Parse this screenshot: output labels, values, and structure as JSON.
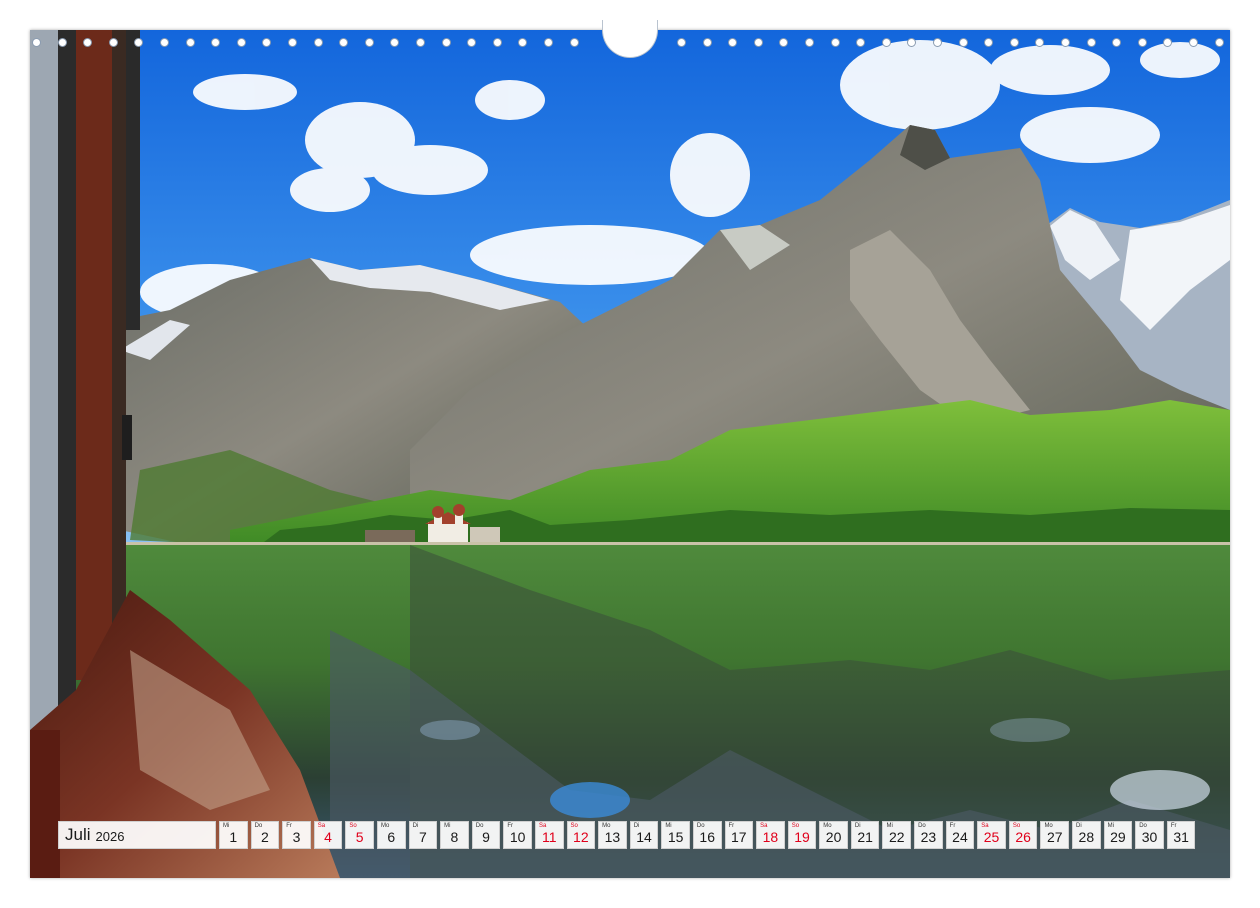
{
  "calendar": {
    "month": "Juli",
    "year": "2026",
    "days": [
      {
        "abbr": "Mi",
        "num": "1",
        "weekend": false
      },
      {
        "abbr": "Do",
        "num": "2",
        "weekend": false
      },
      {
        "abbr": "Fr",
        "num": "3",
        "weekend": false
      },
      {
        "abbr": "Sa",
        "num": "4",
        "weekend": true
      },
      {
        "abbr": "So",
        "num": "5",
        "weekend": true
      },
      {
        "abbr": "Mo",
        "num": "6",
        "weekend": false
      },
      {
        "abbr": "Di",
        "num": "7",
        "weekend": false
      },
      {
        "abbr": "Mi",
        "num": "8",
        "weekend": false
      },
      {
        "abbr": "Do",
        "num": "9",
        "weekend": false
      },
      {
        "abbr": "Fr",
        "num": "10",
        "weekend": false
      },
      {
        "abbr": "Sa",
        "num": "11",
        "weekend": true
      },
      {
        "abbr": "So",
        "num": "12",
        "weekend": true
      },
      {
        "abbr": "Mo",
        "num": "13",
        "weekend": false
      },
      {
        "abbr": "Di",
        "num": "14",
        "weekend": false
      },
      {
        "abbr": "Mi",
        "num": "15",
        "weekend": false
      },
      {
        "abbr": "Do",
        "num": "16",
        "weekend": false
      },
      {
        "abbr": "Fr",
        "num": "17",
        "weekend": false
      },
      {
        "abbr": "Sa",
        "num": "18",
        "weekend": true
      },
      {
        "abbr": "So",
        "num": "19",
        "weekend": true
      },
      {
        "abbr": "Mo",
        "num": "20",
        "weekend": false
      },
      {
        "abbr": "Di",
        "num": "21",
        "weekend": false
      },
      {
        "abbr": "Mi",
        "num": "22",
        "weekend": false
      },
      {
        "abbr": "Do",
        "num": "23",
        "weekend": false
      },
      {
        "abbr": "Fr",
        "num": "24",
        "weekend": false
      },
      {
        "abbr": "Sa",
        "num": "25",
        "weekend": true
      },
      {
        "abbr": "So",
        "num": "26",
        "weekend": true
      },
      {
        "abbr": "Mo",
        "num": "27",
        "weekend": false
      },
      {
        "abbr": "Di",
        "num": "28",
        "weekend": false
      },
      {
        "abbr": "Mi",
        "num": "29",
        "weekend": false
      },
      {
        "abbr": "Do",
        "num": "30",
        "weekend": false
      },
      {
        "abbr": "Fr",
        "num": "31",
        "weekend": false
      }
    ]
  },
  "colors": {
    "weekend": "#e0001b",
    "sky": "#1f7ee6",
    "lake": "#3f7a34",
    "boat_hull": "#7a2c1e"
  }
}
